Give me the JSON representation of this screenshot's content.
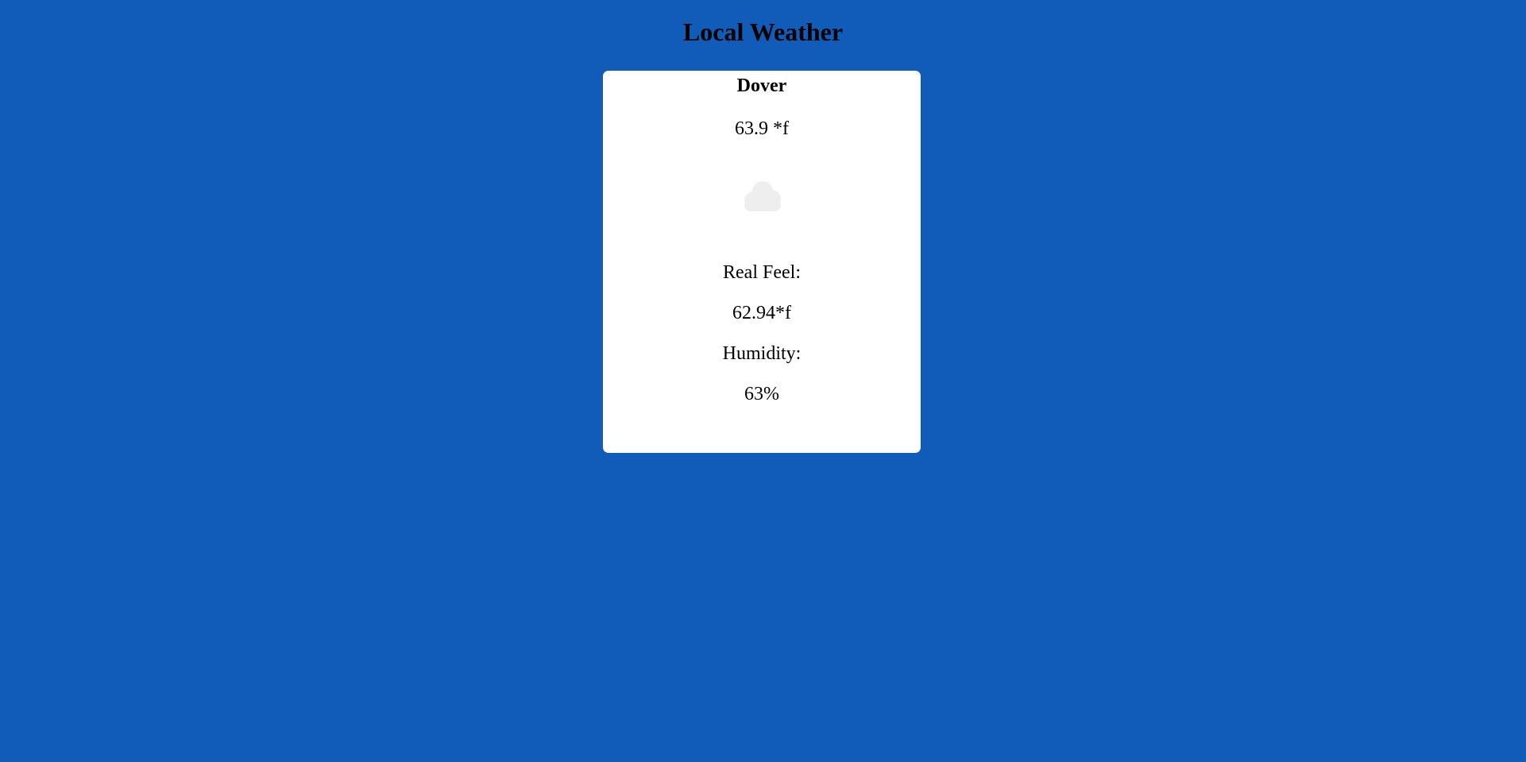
{
  "page": {
    "title": "Local Weather"
  },
  "weather": {
    "city": "Dover",
    "temperature": "63.9 *f",
    "condition_icon": "cloud-icon",
    "real_feel_label": "Real Feel:",
    "real_feel_value": "62.94*f",
    "humidity_label": "Humidity:",
    "humidity_value": "63%"
  },
  "colors": {
    "background": "#115cb9",
    "card": "#ffffff",
    "icon": "#eeeeee",
    "text": "#000000"
  }
}
